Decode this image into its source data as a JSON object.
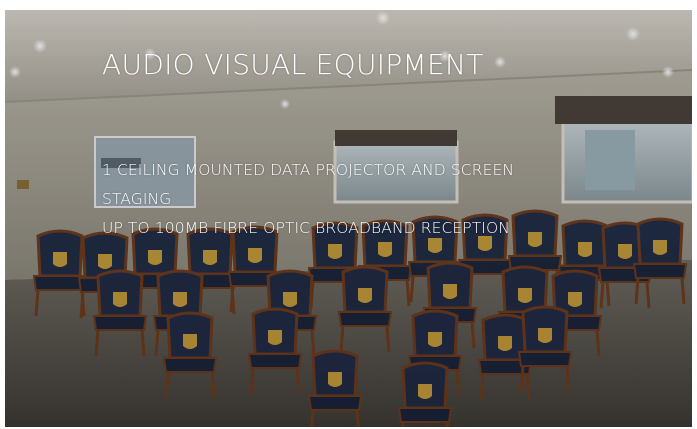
{
  "hero": {
    "title": "AUDIO VISUAL EQUIPMENT",
    "features": [
      "1 CEILING MOUNTED DATA PROJECTOR AND SCREEN",
      "STAGING",
      "UP TO 100MB FIBRE OPTIC BROADBAND RECEPTION"
    ]
  },
  "colors": {
    "heading_text": "#ffffff",
    "ceiling": "#c9c5bc",
    "carpet": "#4a4741",
    "chair_seat": "#1f2a44",
    "chair_frame": "#6b3a1c"
  }
}
